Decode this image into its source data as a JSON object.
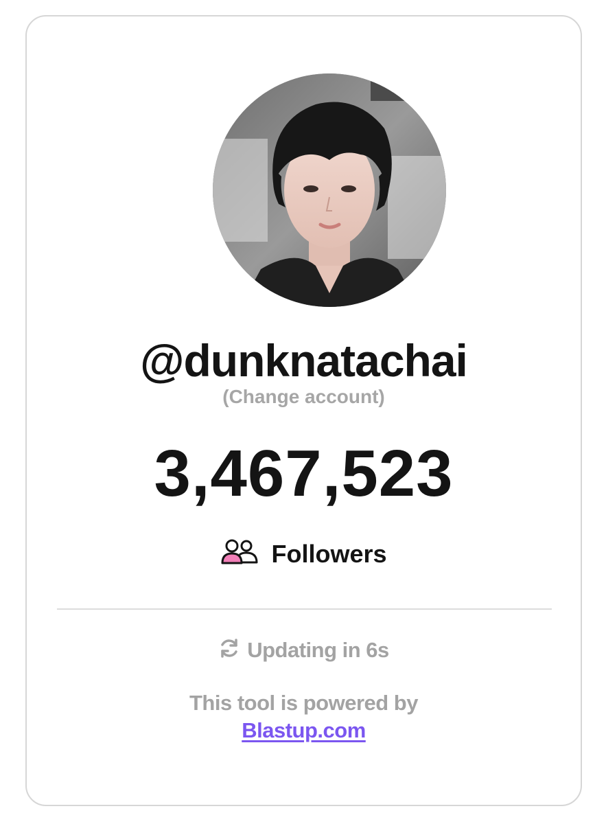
{
  "profile": {
    "username": "@dunknatachai",
    "change_account_label": "(Change account)"
  },
  "stats": {
    "count": "3,467,523",
    "metric_label": "Followers",
    "metric_icon": "followers-icon"
  },
  "status": {
    "updating_text": "Updating in 6s",
    "refresh_icon": "refresh-icon"
  },
  "footer": {
    "powered_text": "This tool is powered by",
    "link_text": "Blastup.com"
  },
  "colors": {
    "text": "#141414",
    "muted": "#a3a3a3",
    "link": "#7b56f0",
    "icon_accent": "#f27fb8",
    "border": "#d6d6d6"
  }
}
